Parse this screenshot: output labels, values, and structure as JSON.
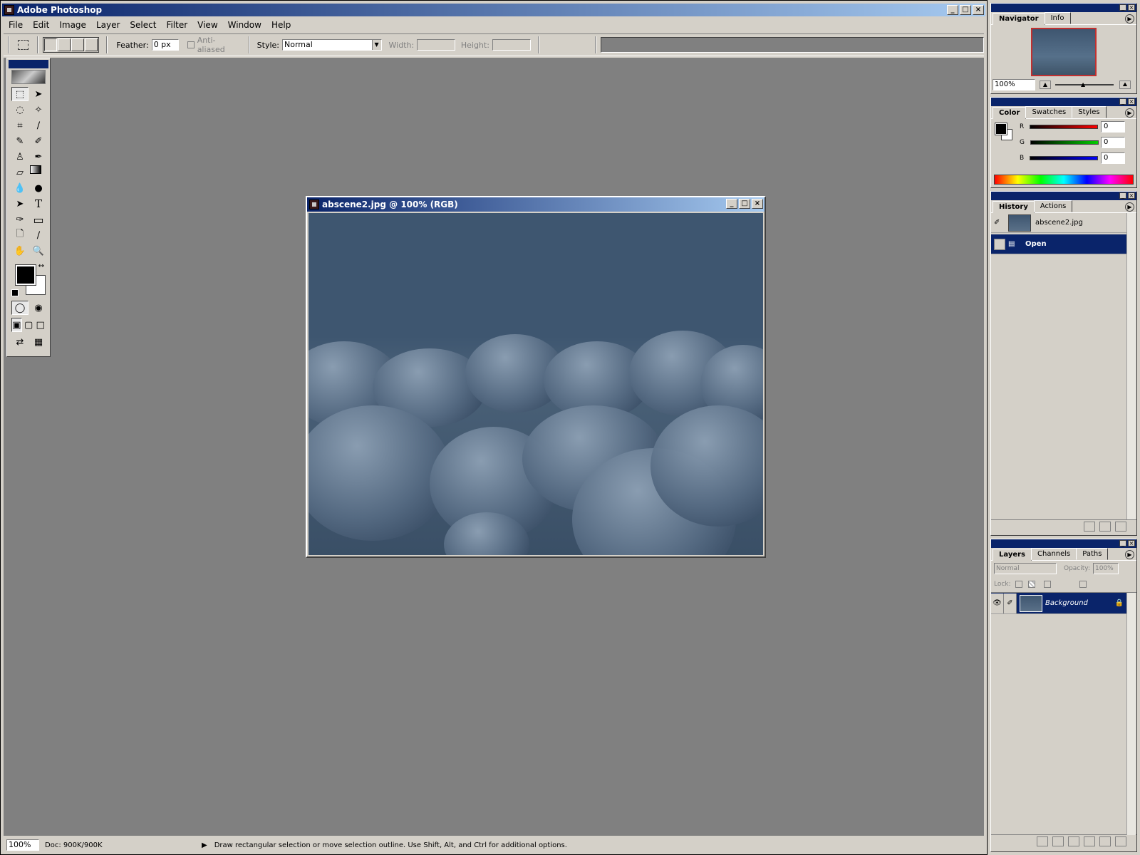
{
  "app": {
    "title": "Adobe Photoshop",
    "window_buttons": [
      "_",
      "□",
      "×"
    ]
  },
  "menu": [
    "File",
    "Edit",
    "Image",
    "Layer",
    "Select",
    "Filter",
    "View",
    "Window",
    "Help"
  ],
  "options": {
    "feather_label": "Feather:",
    "feather_value": "0 px",
    "antialiased_label": "Anti-aliased",
    "style_label": "Style:",
    "style_value": "Normal",
    "width_label": "Width:",
    "height_label": "Height:"
  },
  "document": {
    "title": "abscene2.jpg @ 100% (RGB)"
  },
  "status": {
    "zoom": "100%",
    "doc": "Doc: 900K/900K",
    "hint": "Draw rectangular selection or move selection outline.  Use Shift, Alt, and Ctrl for additional options."
  },
  "navigator": {
    "tabs": [
      "Navigator",
      "Info"
    ],
    "zoom": "100%"
  },
  "color": {
    "tabs": [
      "Color",
      "Swatches",
      "Styles"
    ],
    "channels": [
      {
        "label": "R",
        "value": "0"
      },
      {
        "label": "G",
        "value": "0"
      },
      {
        "label": "B",
        "value": "0"
      }
    ]
  },
  "history": {
    "tabs": [
      "History",
      "Actions"
    ],
    "snapshot": "abscene2.jpg",
    "state": "Open"
  },
  "layers": {
    "tabs": [
      "Layers",
      "Channels",
      "Paths"
    ],
    "blend": "Normal",
    "opacity_label": "Opacity:",
    "opacity": "100%",
    "lock_label": "Lock:",
    "layer_name": "Background"
  },
  "colors": {
    "title_start": "#0a246a",
    "title_end": "#a6caf0",
    "workspace": "#808080",
    "chrome": "#d4d0c8"
  }
}
